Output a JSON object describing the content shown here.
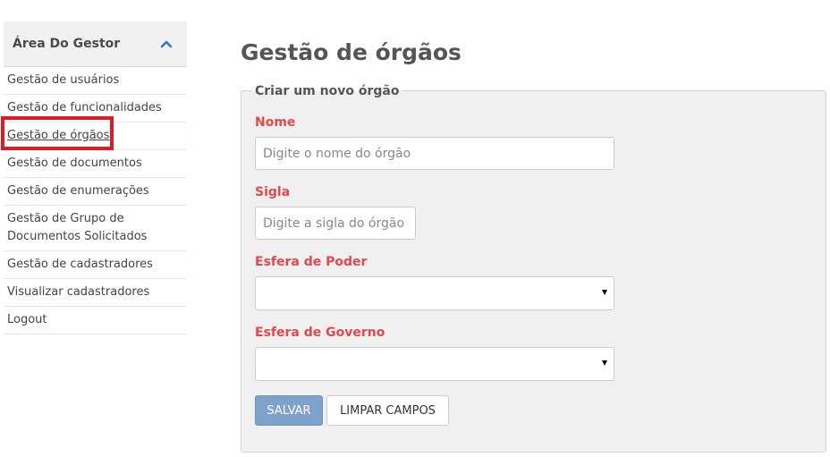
{
  "sidebar": {
    "title": "Área Do Gestor",
    "items": [
      {
        "label": "Gestão de usuários"
      },
      {
        "label": "Gestão de funcionalidades"
      },
      {
        "label": "Gestão de órgãos"
      },
      {
        "label": "Gestão de documentos"
      },
      {
        "label": "Gestão de enumerações"
      },
      {
        "label": "Gestão de Grupo de Documentos Solicitados"
      },
      {
        "label": "Gestão de cadastradores"
      },
      {
        "label": "Visualizar cadastradores"
      },
      {
        "label": "Logout"
      }
    ],
    "active_index": 2
  },
  "page": {
    "title": "Gestão de órgãos"
  },
  "form": {
    "legend": "Criar um novo órgão",
    "nome": {
      "label": "Nome",
      "value": "",
      "placeholder": "Digite o nome do órgão"
    },
    "sigla": {
      "label": "Sigla",
      "value": "",
      "placeholder": "Digite a sigla do órgão"
    },
    "esfera_poder": {
      "label": "Esfera de Poder",
      "selected": ""
    },
    "esfera_governo": {
      "label": "Esfera de Governo",
      "selected": ""
    },
    "save_label": "SALVAR",
    "clear_label": "LIMPAR CAMPOS"
  },
  "colors": {
    "accent_label": "#e2494c",
    "save_button": "#7ea2cb",
    "highlight": "#dd1b24",
    "chevron": "#3b6fc4"
  }
}
